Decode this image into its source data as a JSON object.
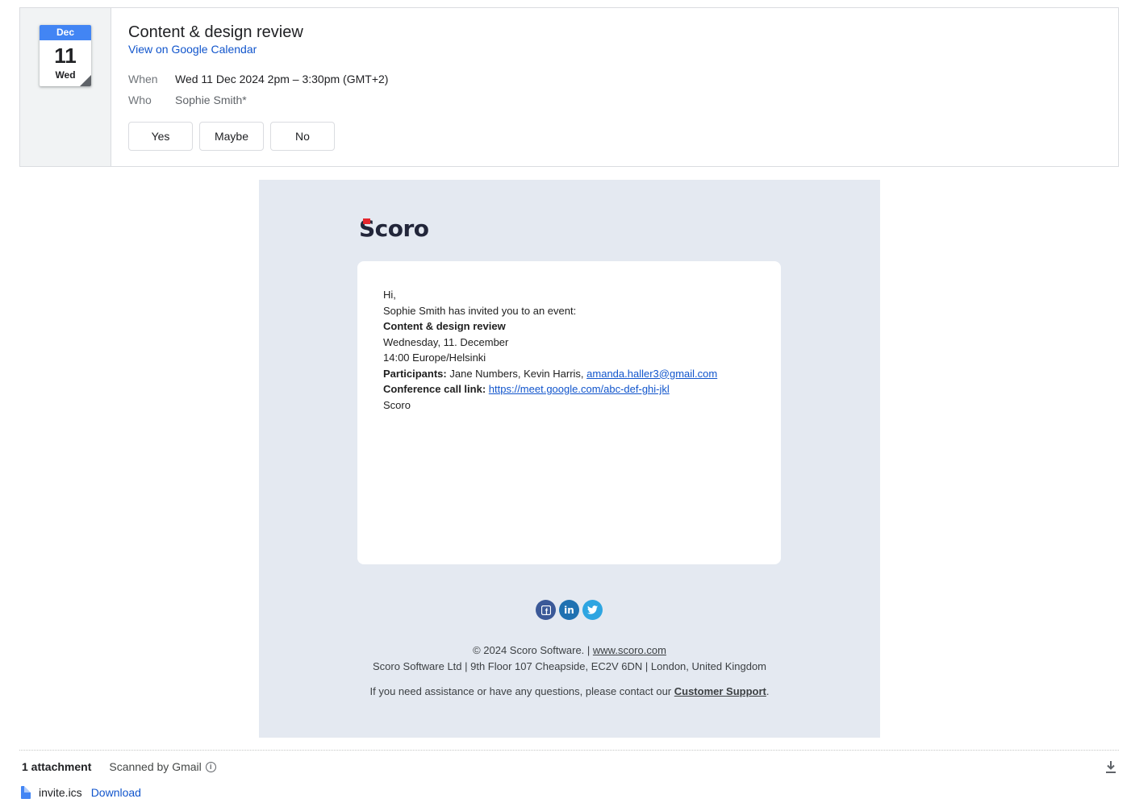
{
  "invite": {
    "calendar": {
      "month": "Dec",
      "day": "11",
      "weekday": "Wed"
    },
    "title": "Content & design review",
    "view_link": "View on Google Calendar",
    "when_label": "When",
    "when_value": "Wed 11 Dec 2024 2pm – 3:30pm (GMT+2)",
    "who_label": "Who",
    "who_value": "Sophie Smith*",
    "rsvp": {
      "yes": "Yes",
      "maybe": "Maybe",
      "no": "No"
    }
  },
  "email": {
    "logo_text": "Scoro",
    "greeting": "Hi,",
    "intro": "Sophie Smith has invited you to an event:",
    "event_name": "Content & design review",
    "event_date": "Wednesday, 11. December",
    "event_time": "14:00 Europe/Helsinki",
    "participants_label": "Participants:",
    "participants_text": " Jane Numbers, Kevin Harris, ",
    "participants_email": "amanda.haller3@gmail.com",
    "conference_label": "Conference call link:",
    "conference_url": "https://meet.google.com/abc-def-ghi-jkl",
    "signature": "Scoro",
    "social": [
      "facebook-icon",
      "linkedin-icon",
      "twitter-icon"
    ],
    "footer": {
      "copyright": "© 2024 Scoro Software. | ",
      "site": "www.scoro.com",
      "address": "Scoro Software Ltd | 9th Floor 107 Cheapside, EC2V 6DN | London, United Kingdom",
      "help_text": "If you need assistance or have any questions, please contact our ",
      "help_link": "Customer Support",
      "help_end": "."
    }
  },
  "attachments": {
    "count_label": "1 attachment",
    "scanned_label": "Scanned by Gmail",
    "file_name": "invite.ics",
    "download_label": "Download"
  },
  "colors": {
    "calendar_blue": "#4285f4",
    "link_blue": "#1155cc",
    "email_background": "#e4e9f1",
    "logo_red": "#e3262d"
  }
}
